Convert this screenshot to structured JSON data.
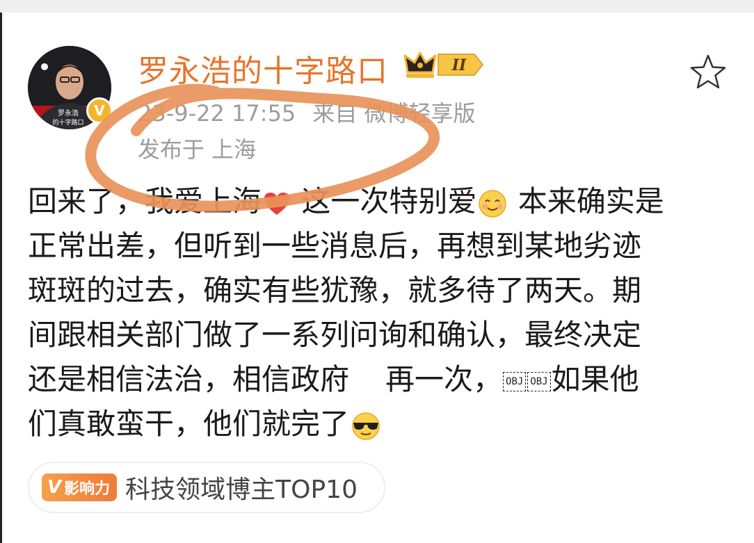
{
  "post": {
    "author": {
      "name": "罗永浩的十字路口",
      "avatar_caption_line1": "罗永浩",
      "avatar_caption_line2": "的十字路口",
      "verified_mark": "V",
      "vip_level": "II"
    },
    "meta": {
      "timestamp": "23-9-22 17:55",
      "source": "来自 微博轻享版",
      "location": "发布于 上海"
    },
    "body_lines": {
      "l1a": "回来了，我爱上海",
      "l1b": " 这一次特别爱",
      "l1c": " 本来确实是",
      "l2": "正常出差，但听到一些消息后，再想到某地劣迹",
      "l3": "斑斑的过去，确实有些犹豫，就多待了两天。期",
      "l4": "间跟相关部门做了一系列问询和确认，最终决定",
      "l5a": "还是相信法治，相信政府",
      "l5b": "再一次，",
      "l5_obj1": "OBJ",
      "l5_obj2": "OBJ",
      "l5c": "如果他",
      "l6": "们真敢蛮干，他们就完了"
    },
    "influence": {
      "badge_letter": "V",
      "badge_label": "影响力",
      "text": "科技领域博主TOP10"
    }
  },
  "colors": {
    "username": "#e8742a",
    "meta_text": "#9c9c9c",
    "body_text": "#1a1a1a",
    "annotation_stroke": "#e8935a"
  },
  "icons": {
    "favorite": "star-outline-icon",
    "vip": "crown-icon",
    "verified": "verified-v-icon",
    "heart": "heart-emoji-icon",
    "smile": "smile-emoji-icon",
    "cool": "sunglasses-emoji-icon"
  }
}
